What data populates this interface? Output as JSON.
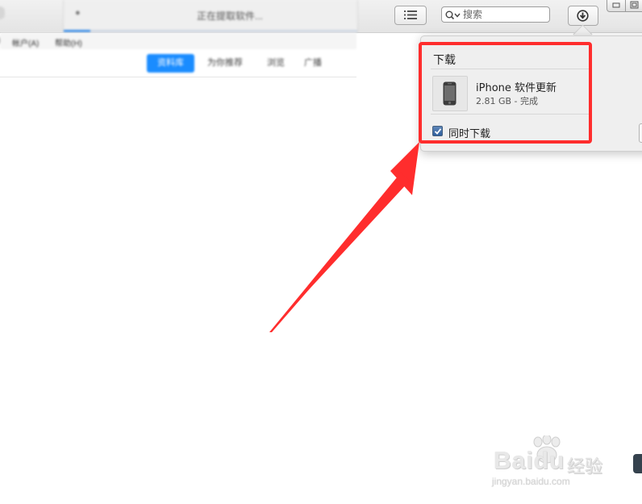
{
  "toolbar": {
    "status_text": "正在提取软件...",
    "search_placeholder": "搜索",
    "list_icon": "list-icon",
    "download_icon": "download-arrow-icon"
  },
  "menu": {
    "items": [
      "帐户(A)",
      "帮助(H)"
    ]
  },
  "store_tabs": [
    {
      "label": "资料库",
      "active": true
    },
    {
      "label": "为你推荐",
      "active": false
    },
    {
      "label": "浏览",
      "active": false
    },
    {
      "label": "广播",
      "active": false
    }
  ],
  "downloads": {
    "title": "下载",
    "item": {
      "name": "iPhone 软件更新",
      "meta": "2.81 GB - 完成",
      "icon": "iphone-icon"
    },
    "simultaneous_label": "同时下载",
    "simultaneous_checked": true
  },
  "watermark": {
    "brand": "Baidu",
    "sub": "经验",
    "url": "jingyan.baidu.com"
  },
  "colors": {
    "highlight": "#ff2d2d",
    "accent": "#1a8cff",
    "popover_bg": "#efefef"
  }
}
